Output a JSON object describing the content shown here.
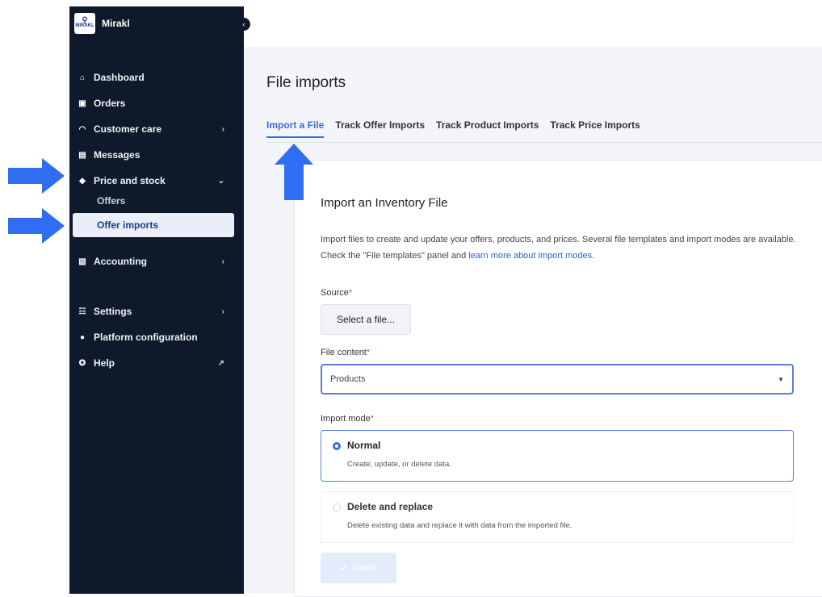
{
  "app": {
    "brand_name": "Mirakl",
    "logo_text": "MIRAKL"
  },
  "sidebar": {
    "items": [
      {
        "label": "Dashboard",
        "icon": "home-icon"
      },
      {
        "label": "Orders",
        "icon": "orders-icon"
      },
      {
        "label": "Customer care",
        "icon": "customer-care-icon"
      },
      {
        "label": "Messages",
        "icon": "messages-icon"
      },
      {
        "label": "Price and stock",
        "icon": "tag-icon"
      },
      {
        "label": "Accounting",
        "icon": "accounting-icon"
      },
      {
        "label": "Settings",
        "icon": "settings-icon"
      },
      {
        "label": "Platform configuration",
        "icon": "info-icon"
      },
      {
        "label": "Help",
        "icon": "help-icon"
      }
    ],
    "sub_items": [
      {
        "label": "Offers"
      },
      {
        "label": "Offer imports",
        "active": true
      }
    ]
  },
  "page": {
    "title": "File imports",
    "tabs": [
      {
        "label": "Import a File",
        "active": true
      },
      {
        "label": "Track Offer Imports"
      },
      {
        "label": "Track Product Imports"
      },
      {
        "label": "Track Price Imports"
      }
    ]
  },
  "form": {
    "title": "Import an Inventory File",
    "description": "Import files to create and update your offers, products, and prices. Several file templates and import modes are available. Check the \"File templates\" panel and ",
    "description_link": "learn more about import modes.",
    "source_label": "Source",
    "source_button": "Select a file...",
    "content_label": "File content",
    "content_value": "Products",
    "mode_label": "Import mode",
    "required_mark": "*",
    "modes": [
      {
        "label": "Normal",
        "desc": "Create, update, or delete data.",
        "selected": true
      },
      {
        "label": "Delete and replace",
        "desc": "Delete existing data and replace it with data from the imported file.",
        "selected": false
      }
    ],
    "submit_label": "Import"
  },
  "colors": {
    "sidebar_bg": "#0e1a2b",
    "accent": "#3a6fd8",
    "arrow": "#2f6df2"
  }
}
